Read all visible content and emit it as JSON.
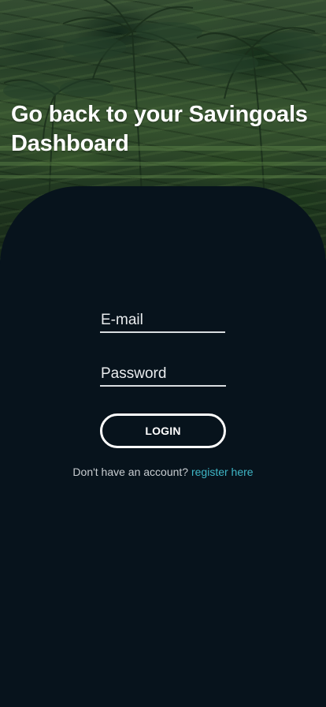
{
  "hero": {
    "title": "Go back to your Savingoals Dashboard",
    "background": "rice-terrace-palm-photo"
  },
  "form": {
    "email_placeholder": "E-mail",
    "email_value": "",
    "password_placeholder": "Password",
    "password_value": "",
    "login_label": "LOGIN"
  },
  "register": {
    "prompt": "Don't have an account?",
    "link_label": "register here"
  },
  "colors": {
    "panel": "#07131c",
    "link": "#3fb6c6",
    "text": "#ffffff"
  }
}
